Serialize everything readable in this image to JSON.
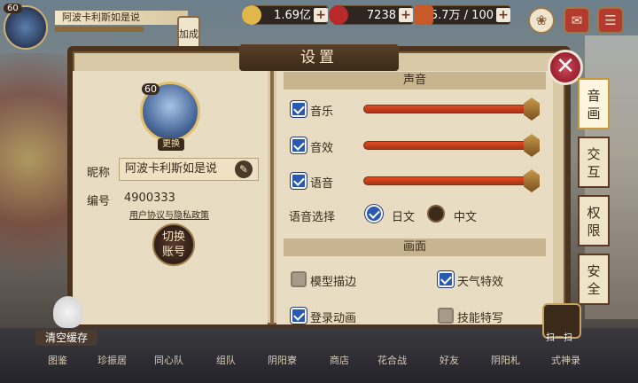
{
  "topbar": {
    "player_level": "60",
    "player_name": "阿波卡利斯如是说",
    "resources": [
      {
        "value": "1.69亿",
        "icon": "coin-icon"
      },
      {
        "value": "7238",
        "icon": "jade-icon"
      },
      {
        "value": "5.7万 / 100",
        "icon": "stamina-icon"
      }
    ],
    "plus": "+",
    "side_label": "加成"
  },
  "modal": {
    "title": "设置",
    "close": "✕"
  },
  "profile": {
    "level": "60",
    "change_avatar": "更换",
    "nick_label": "昵称",
    "nickname": "阿波卡利斯如是说",
    "id_label": "编号",
    "id": "4900333",
    "policy": "用户协议与隐私政策",
    "switch_account_1": "切换",
    "switch_account_2": "账号"
  },
  "sound": {
    "header": "声音",
    "music": "音乐",
    "effects": "音效",
    "voice": "语音",
    "music_level": 1.0,
    "effects_level": 1.0,
    "voice_level": 1.0,
    "voice_select_label": "语音选择",
    "japanese": "日文",
    "chinese": "中文",
    "selected_language": "日文"
  },
  "graphics": {
    "header": "画面",
    "model_outline": "模型描边",
    "weather_effects": "天气特效",
    "login_animation": "登录动画",
    "skill_effects": "技能特写",
    "model_outline_on": false,
    "weather_effects_on": true,
    "login_animation_on": true,
    "skill_effects_on": false
  },
  "tabs": [
    {
      "label_1": "音",
      "label_2": "画"
    },
    {
      "label_1": "交",
      "label_2": "互"
    },
    {
      "label_1": "权",
      "label_2": "限"
    },
    {
      "label_1": "安",
      "label_2": "全"
    }
  ],
  "bottom": {
    "clear_cache": "清空缓存",
    "scan": "扫一扫",
    "items": [
      "图鉴",
      "珍振居",
      "同心队",
      "组队",
      "阴阳寮",
      "商店",
      "花合战",
      "好友",
      "阴阳札",
      "式神录"
    ]
  },
  "colors": {
    "accent_blue": "#2a5ab0",
    "slider_red": "#e04a20",
    "frame_brown": "#4a3420",
    "close_red": "#d24a5a"
  }
}
